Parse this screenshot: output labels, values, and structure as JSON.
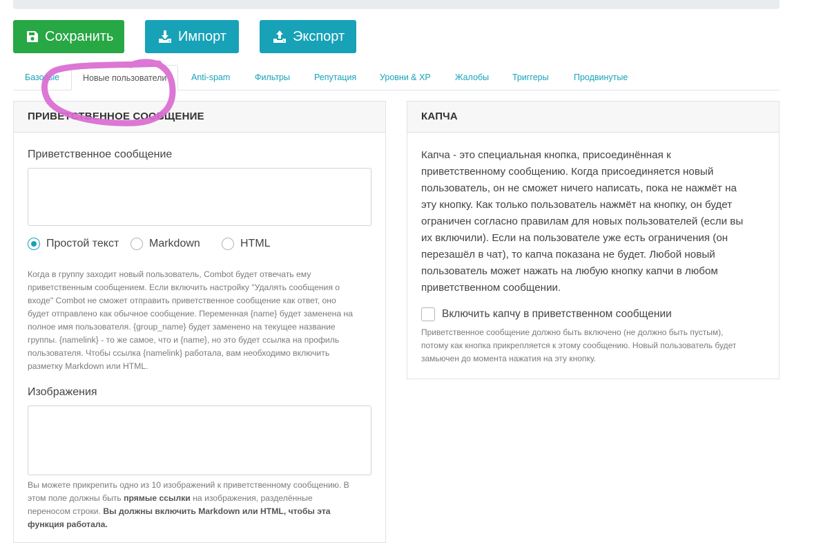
{
  "toolbar": {
    "save_label": "Сохранить",
    "import_label": "Импорт",
    "export_label": "Экспорт",
    "save_color": "#28a745",
    "import_color": "#17a2b8",
    "export_color": "#17a2b8"
  },
  "tabs": [
    {
      "label": "Базовые",
      "active": false
    },
    {
      "label": "Новые пользователи",
      "active": true
    },
    {
      "label": "Anti-spam",
      "active": false
    },
    {
      "label": "Фильтры",
      "active": false
    },
    {
      "label": "Репутация",
      "active": false
    },
    {
      "label": "Уровни & XP",
      "active": false
    },
    {
      "label": "Жалобы",
      "active": false
    },
    {
      "label": "Триггеры",
      "active": false
    },
    {
      "label": "Продвинутые",
      "active": false
    }
  ],
  "welcome": {
    "header": "ПРИВЕТСТВЕННОЕ СООБЩЕНИЕ",
    "message_label": "Приветственное сообщение",
    "message_value": "",
    "format_options": [
      {
        "label": "Простой текст",
        "checked": true
      },
      {
        "label": "Markdown",
        "checked": false
      },
      {
        "label": "HTML",
        "checked": false
      }
    ],
    "help_lines": [
      "Когда в группу заходит новый пользователь, Combot будет отвечать ему",
      "приветственным сообщением. Если включить настройку \"Удалять сообщения о",
      "входе\" Combot не сможет отправить приветственное сообщение как ответ, оно",
      "будет отправлено как обычное сообщение. Переменная {name} будет заменена на",
      "полное имя пользователя. {group_name} будет заменено на текущее название",
      "группы. {namelink} - то же самое, что и {name}, но это будет ссылка на профиль",
      "пользователя. Чтобы ссылка {namelink} работала, вам необходимо включить",
      "разметку Markdown или HTML."
    ],
    "images_label": "Изображения",
    "images_value": "",
    "images_help": {
      "line1": "Вы можете прикрепить одно из 10 изображений к приветственному сообщению. В",
      "line2_prefix": "этом поле должны быть ",
      "line2_bold": "прямые ссылки",
      "line2_suffix": " на изображения, разделённые",
      "line3_prefix": "переносом строки. ",
      "line3_bold": "Вы должны включить Markdown или HTML, чтобы эта",
      "line4_bold": "функция работала."
    }
  },
  "captcha": {
    "header": "КАПЧА",
    "description_lines": [
      "Капча - это специальная кнопка, присоединённая к",
      "приветственному сообщению. Когда присоединяется новый",
      "пользователь, он не сможет ничего написать, пока не нажмёт на",
      "эту кнопку. Как только пользователь нажмёт на кнопку, он будет",
      "ограничен согласно правилам для новых пользователей (если вы",
      "их включили). Если на пользователе уже есть ограничения (он",
      "перезашёл в чат), то капча показана не будет. Любой новый",
      "пользователь может нажать на любую кнопку капчи в любом",
      "приветственном сообщении."
    ],
    "checkbox_label": "Включить капчу в приветственном сообщении",
    "checkbox_checked": false,
    "help_lines": [
      "Приветственное сообщение должно быть включено (не должно быть пустым),",
      "потому как кнопка прикрепляется к этому сообщению. Новый пользователь будет",
      "замьючен до момента нажатия на эту кнопку."
    ]
  },
  "annotation_color": "#d96bd1"
}
